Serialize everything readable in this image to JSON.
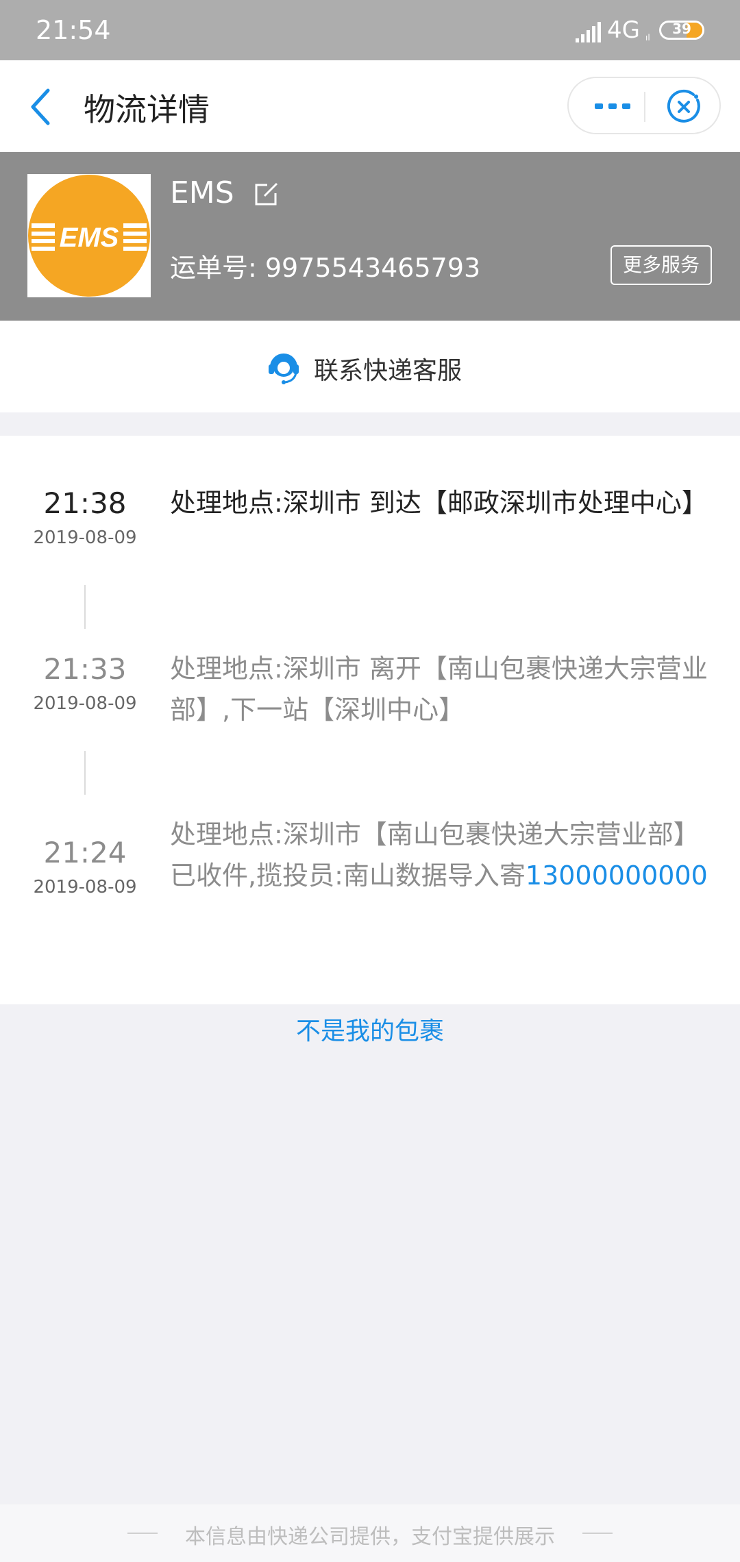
{
  "status_bar": {
    "time": "21:54",
    "network": "4G",
    "network_sub": "ıl",
    "battery": "39",
    "battery_level": 0.39
  },
  "nav": {
    "title": "物流详情"
  },
  "carrier": {
    "name": "EMS",
    "logo_text": "EMS",
    "logo_color": "#f5a623",
    "waybill": "运单号: 9975543465793",
    "more_services": "更多服务"
  },
  "contact": {
    "label": "联系快递客服"
  },
  "timeline": [
    {
      "time": "21:38",
      "date": "2019-08-09",
      "desc": "处理地点:深圳市 到达【邮政深圳市处理中心】"
    },
    {
      "time": "21:33",
      "date": "2019-08-09",
      "desc": "处理地点:深圳市 离开【南山包裹快递大宗营业部】,下一站【深圳中心】"
    },
    {
      "time": "21:24",
      "date": "2019-08-09",
      "desc": "处理地点:深圳市【南山包裹快递大宗营业部】已收件,揽投员:南山数据导入寄",
      "phone": "13000000000"
    }
  ],
  "not_mine": "不是我的包裹",
  "footer": "本信息由快递公司提供，支付宝提供展示",
  "colors": {
    "accent": "#1a8ee6",
    "header_gray": "#8d8d8d",
    "ems_orange": "#f5a623"
  }
}
